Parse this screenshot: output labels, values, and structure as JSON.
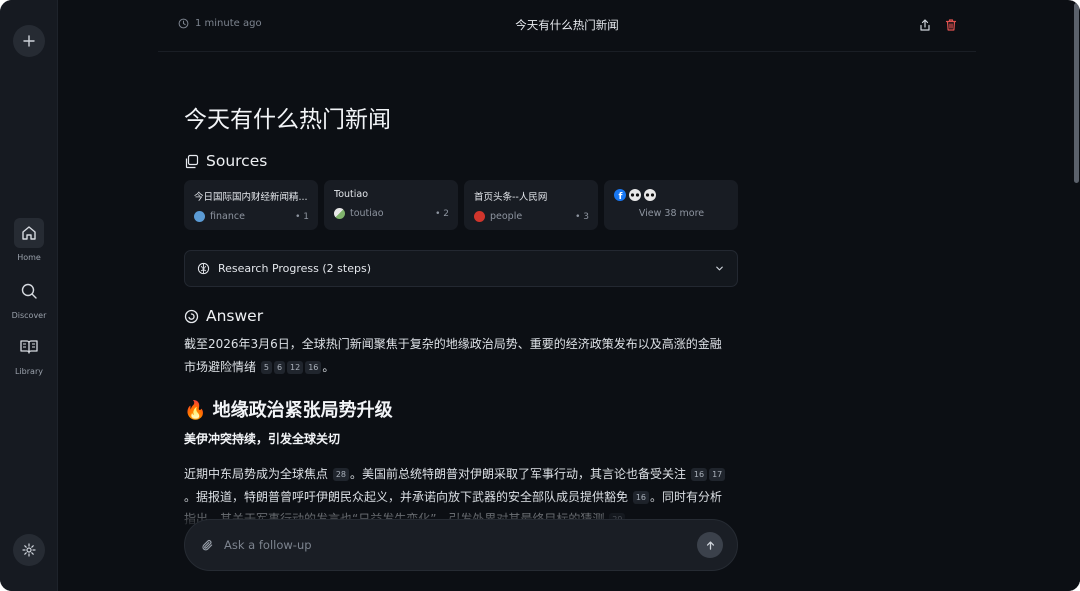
{
  "sidebar": {
    "nav": [
      {
        "label": "Home",
        "icon": "home-icon"
      },
      {
        "label": "Discover",
        "icon": "search-icon"
      },
      {
        "label": "Library",
        "icon": "book-icon"
      }
    ]
  },
  "header": {
    "time": "1 minute ago",
    "title": "今天有什么热门新闻"
  },
  "page": {
    "heading": "今天有什么热门新闻",
    "sources_label": "Sources",
    "sources": [
      {
        "title": "今日国际国内财经新闻精...",
        "site": "finance",
        "num": "• 1",
        "color": "#5b9bd5"
      },
      {
        "title": "Toutiao",
        "site": "toutiao",
        "num": "• 2",
        "color": "#e8e8e8"
      },
      {
        "title": "首页头条--人民网",
        "site": "people",
        "num": "• 3",
        "color": "#d0352c"
      }
    ],
    "more_label": "View 38 more",
    "research_label": "Research Progress (2 steps)",
    "answer_label": "Answer",
    "intro": {
      "text": "截至2026年3月6日，全球热门新闻聚焦于复杂的地缘政治局势、重要的经济政策发布以及高涨的金融市场避险情绪",
      "cites": [
        "5",
        "6",
        "12",
        "16"
      ],
      "end": "。"
    },
    "section_title": "🔥 地缘政治紧张局势升级",
    "subsection_title": "美伊冲突持续，引发全球关切",
    "body": {
      "t1": "近期中东局势成为全球焦点",
      "c1": "28",
      "t2": "。美国前总统特朗普对伊朗采取了军事行动，其言论也备受关注",
      "c2": "16",
      "c3": "17",
      "t3": "。据报道，特朗普曾呼吁伊朗民众起义，并承诺向放下武器的安全部队成员提供豁免",
      "c4": "16",
      "t4": "。同时有分析指出，其关于军事行动的发言也“日益发生变化”，引发外界对其最终目标的猜测",
      "c5": "29",
      "t5": "。"
    }
  },
  "followup": {
    "placeholder": "Ask a follow-up"
  },
  "colors": {
    "background": "#0c0f14",
    "sidebar": "#161a21",
    "card": "#181c23",
    "delete": "#e0524f"
  }
}
